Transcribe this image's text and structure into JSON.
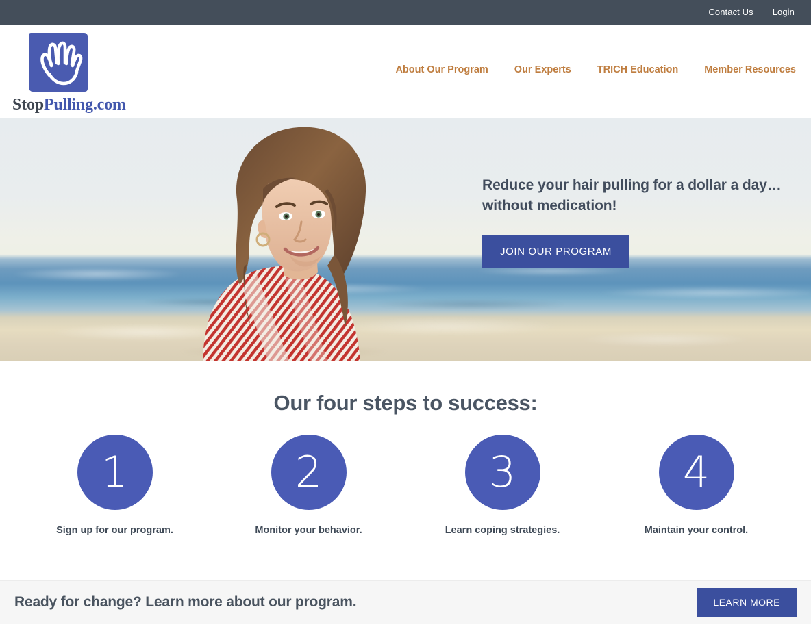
{
  "topbar": {
    "links": [
      {
        "label": "Contact Us",
        "name": "contact-us-link"
      },
      {
        "label": "Login",
        "name": "login-link"
      }
    ]
  },
  "header": {
    "logo": {
      "icon": "hand-icon",
      "word_dark": "Stop",
      "word_blue": "Pulling.com"
    },
    "nav": [
      {
        "label": "About Our Program"
      },
      {
        "label": "Our Experts"
      },
      {
        "label": "TRICH Education"
      },
      {
        "label": "Member Resources"
      }
    ]
  },
  "hero": {
    "headline_line1": "Reduce your hair pulling for a dollar a day…",
    "headline_line2": "without medication!",
    "cta_label": "JOIN OUR PROGRAM",
    "image_alt": "woman-on-beach-photo"
  },
  "steps_section": {
    "title": "Our four steps to success:",
    "steps": [
      {
        "number": "1",
        "label": "Sign up for our program."
      },
      {
        "number": "2",
        "label": "Monitor your behavior."
      },
      {
        "number": "3",
        "label": "Learn coping strategies."
      },
      {
        "number": "4",
        "label": "Maintain your control."
      }
    ]
  },
  "cta_bar": {
    "text": "Ready for change? Learn more about our program.",
    "button_label": "LEARN MORE"
  },
  "colors": {
    "topbar_bg": "#444e5a",
    "nav_link": "#bf7d3f",
    "button_blue": "#3b4f9e",
    "circle_blue": "#4a5bb5",
    "logo_blue": "#4257ad",
    "heading_gray": "#49535f",
    "cta_bar_bg": "#f6f6f6"
  }
}
